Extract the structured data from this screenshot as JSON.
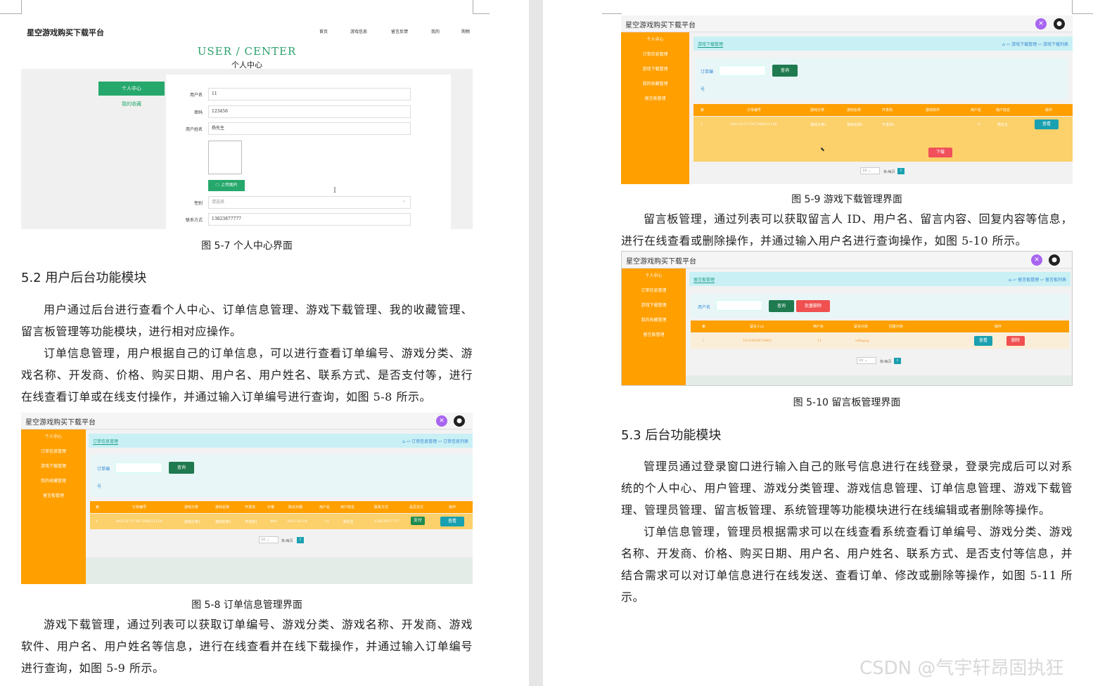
{
  "left_page": {
    "fig57": {
      "site_title": "星空游戏购买下载平台",
      "nav": [
        "首页",
        "游戏信息",
        "留言反馈",
        "我的",
        "购物"
      ],
      "banner_en": "USER / CENTER",
      "banner_cn": "个人中心",
      "menu": [
        "个人中心",
        "我的收藏"
      ],
      "fields": [
        {
          "label": "用户名",
          "value": "11"
        },
        {
          "label": "密码",
          "value": "123456"
        },
        {
          "label": "用户姓名",
          "value": "杨先生"
        }
      ],
      "upload_btn": "上传图片",
      "gender_label": "性别",
      "gender_placeholder": "请选择",
      "phone_label": "联系方式",
      "phone_value": "13823877777",
      "caption": "图 5-7 个人中心界面"
    },
    "section_title": "5.2 用户后台功能模块",
    "para1": "用户通过后台进行查看个人中心、订单信息管理、游戏下载管理、我的收藏管理、留言板管理等功能模块，进行相对应操作。",
    "para2": "订单信息管理，用户根据自己的订单信息，可以进行查看订单编号、游戏分类、游戏名称、开发商、价格、购买日期、用户名、用户姓名、联系方式、是否支付等，进行在线查看订单或在线支付操作，并通过输入订单编号进行查询，如图 5-8 所示。",
    "fig58": {
      "title": "星空游戏购买下载平台",
      "side": [
        "个人中心",
        "订单信息管理",
        "游戏下载管理",
        "我的收藏管理",
        "留言板管理"
      ],
      "crumb": "订单信息管理",
      "crumb_right": "⌂ ↩ 订单信息管理 ↩ 订单信息列表",
      "search_label": "订单编",
      "search_label2": "号",
      "search_btn": "查询",
      "headers": [
        "索",
        "订单编号",
        "游戏分类",
        "游戏名称",
        "开发商",
        "价格",
        "购买日期",
        "用户名",
        "用户姓名",
        "联系方式",
        "是否支付",
        "操作"
      ],
      "row": [
        "1",
        "202131711347268521126",
        "游戏分类1",
        "游戏名称1",
        "开发商1",
        "400",
        "2021-03-18",
        "11",
        "杨先生",
        "13823877777",
        "支付",
        "查看"
      ],
      "pager_size": "10",
      "pager_text": "条/每页",
      "page": "1",
      "caption": "图 5-8 订单信息管理界面"
    },
    "para3": "游戏下载管理，通过列表可以获取订单编号、游戏分类、游戏名称、开发商、游戏软件、用户名、用户姓名等信息，进行在线查看并在线下载操作，并通过输入订单编号进行查询，如图 5-9 所示。"
  },
  "right_page": {
    "fig59": {
      "title": "星空游戏购买下载平台",
      "side": [
        "个人中心",
        "订单信息管理",
        "游戏下载管理",
        "我的收藏管理",
        "留言板管理"
      ],
      "crumb": "游戏下载管理",
      "crumb_right": "⌂ ↩ 游戏下载管理 ↩ 游戏下载列表",
      "search_label": "订单编",
      "search_label2": "号",
      "search_btn": "查询",
      "headers": [
        "索",
        "订单编号",
        "游戏分类",
        "游戏名称",
        "开发商",
        "游戏软件",
        "用户名",
        "用户姓名",
        "操作"
      ],
      "row": [
        "1",
        "202131711347268521126",
        "游戏分类1",
        "游戏名称1",
        "开发商1",
        "",
        "11",
        "杨先生",
        "查看"
      ],
      "download_btn": "下载",
      "pager_size": "10",
      "pager_text": "条/每页",
      "page": "1",
      "caption": "图 5-9 游戏下载管理界面"
    },
    "para4": "留言板管理，通过列表可以获取留言人 ID、用户名、留言内容、回复内容等信息，进行在线查看或删除操作，并通过输入用户名进行查询操作，如图 5-10 所示。",
    "fig510": {
      "title": "星空游戏购买下载平台",
      "side": [
        "个人中心",
        "订单信息管理",
        "游戏下载管理",
        "我的收藏管理",
        "留言板管理"
      ],
      "crumb": "留言板管理",
      "crumb_right": "⌂ ↩ 留言板管理 ↩ 留言板列表",
      "search_label": "用户名",
      "search_btn": "查询",
      "batch_btn": "批量删除",
      "headers": [
        "索",
        "留言人id",
        "用户名",
        "留言内容",
        "回复内容",
        "操作"
      ],
      "row": [
        "1",
        "1615959974962",
        "11",
        "sdfsgag",
        ""
      ],
      "view_btn": "查看",
      "del_btn": "删除",
      "pager_size": "10",
      "pager_text": "条/每页",
      "page": "1",
      "caption": "图 5-10 留言板管理界面"
    },
    "section_title": "5.3 后台功能模块",
    "para5": "管理员通过登录窗口进行输入自己的账号信息进行在线登录，登录完成后可以对系统的个人中心、用户管理、游戏分类管理、游戏信息管理、订单信息管理、游戏下载管理、管理员管理、留言板管理、系统管理等功能模块进行在线编辑或者删除等操作。",
    "para6": "订单信息管理，管理员根据需求可以在线查看系统查看订单编号、游戏分类、游戏名称、开发商、价格、购买日期、用户名、用户姓名、联系方式、是否支付等信息，并结合需求可以对订单信息进行在线发送、查看订单、修改或删除等操作，如图 5-11 所示。"
  },
  "watermark": "CSDN @气宇轩昂固执狂",
  "colors": {
    "sidebar": "#ff9f00",
    "accent_green": "#26a86c",
    "teal": "#1a9c8a",
    "table_row": "#fcd06a"
  }
}
